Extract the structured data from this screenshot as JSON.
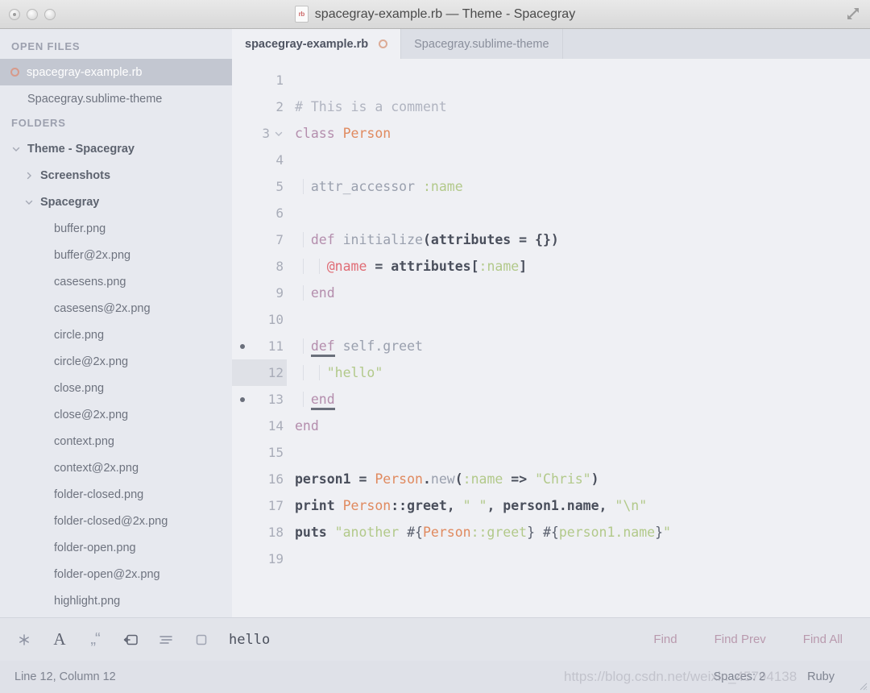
{
  "window": {
    "title": "spacegray-example.rb — Theme - Spacegray",
    "file_badge": "rb",
    "expand_icon": "fullscreen-icon"
  },
  "sidebar": {
    "open_files_header": "OPEN FILES",
    "open_files": [
      {
        "label": "spacegray-example.rb",
        "selected": true,
        "icon": "modified-circle-icon"
      },
      {
        "label": "Spacegray.sublime-theme",
        "selected": false
      }
    ],
    "folders_header": "FOLDERS",
    "folders": [
      {
        "label": "Theme - Spacegray",
        "expanded": true,
        "depth": 0
      },
      {
        "label": "Screenshots",
        "expanded": false,
        "depth": 1
      },
      {
        "label": "Spacegray",
        "expanded": true,
        "depth": 1
      }
    ],
    "files": [
      "buffer.png",
      "buffer@2x.png",
      "casesens.png",
      "casesens@2x.png",
      "circle.png",
      "circle@2x.png",
      "close.png",
      "close@2x.png",
      "context.png",
      "context@2x.png",
      "folder-closed.png",
      "folder-closed@2x.png",
      "folder-open.png",
      "folder-open@2x.png",
      "highlight.png"
    ]
  },
  "tabs": [
    {
      "label": "spacegray-example.rb",
      "active": true,
      "modified": true
    },
    {
      "label": "Spacegray.sublime-theme",
      "active": false,
      "modified": false
    }
  ],
  "editor": {
    "current_line": 12,
    "bookmarked_lines": [
      11,
      13
    ],
    "fold_lines": [
      3
    ],
    "lines": [
      {
        "n": 1,
        "tokens": []
      },
      {
        "n": 2,
        "tokens": [
          {
            "t": "# This is a comment",
            "c": "c-comment"
          }
        ]
      },
      {
        "n": 3,
        "tokens": [
          {
            "t": "class ",
            "c": "c-keyword"
          },
          {
            "t": "Person",
            "c": "c-class"
          }
        ]
      },
      {
        "n": 4,
        "tokens": []
      },
      {
        "n": 5,
        "tokens": [
          {
            "t": "  attr_accessor ",
            "c": "c-func"
          },
          {
            "t": ":name",
            "c": "c-symbol"
          }
        ]
      },
      {
        "n": 6,
        "tokens": []
      },
      {
        "n": 7,
        "tokens": [
          {
            "t": "  def ",
            "c": "c-keyword"
          },
          {
            "t": "initialize",
            "c": "c-func"
          },
          {
            "t": "(",
            "c": "c-bold"
          },
          {
            "t": "attributes",
            "c": "c-bold"
          },
          {
            "t": " = {})",
            "c": "c-bold"
          }
        ]
      },
      {
        "n": 8,
        "tokens": [
          {
            "t": "    ",
            "c": "c-plain"
          },
          {
            "t": "@name",
            "c": "c-ivar"
          },
          {
            "t": " = ",
            "c": "c-bold"
          },
          {
            "t": "attributes",
            "c": "c-bold"
          },
          {
            "t": "[",
            "c": "c-bold"
          },
          {
            "t": ":name",
            "c": "c-symbol"
          },
          {
            "t": "]",
            "c": "c-bold"
          }
        ]
      },
      {
        "n": 9,
        "tokens": [
          {
            "t": "  end",
            "c": "c-keyword"
          }
        ]
      },
      {
        "n": 10,
        "tokens": []
      },
      {
        "n": 11,
        "tokens": [
          {
            "t": "  ",
            "c": "c-plain"
          },
          {
            "t": "def",
            "c": "c-keyword underline"
          },
          {
            "t": " self.greet",
            "c": "c-func"
          }
        ]
      },
      {
        "n": 12,
        "tokens": [
          {
            "t": "    ",
            "c": "c-plain"
          },
          {
            "t": "\"hello\"",
            "c": "c-string"
          }
        ]
      },
      {
        "n": 13,
        "tokens": [
          {
            "t": "  ",
            "c": "c-plain"
          },
          {
            "t": "end",
            "c": "c-keyword underline"
          }
        ]
      },
      {
        "n": 14,
        "tokens": [
          {
            "t": "end",
            "c": "c-keyword"
          }
        ]
      },
      {
        "n": 15,
        "tokens": []
      },
      {
        "n": 16,
        "tokens": [
          {
            "t": "person1",
            "c": "c-bold"
          },
          {
            "t": " = ",
            "c": "c-bold"
          },
          {
            "t": "Person",
            "c": "c-class"
          },
          {
            "t": ".",
            "c": "c-bold"
          },
          {
            "t": "new",
            "c": "c-func"
          },
          {
            "t": "(",
            "c": "c-bold"
          },
          {
            "t": ":name",
            "c": "c-symbol"
          },
          {
            "t": " => ",
            "c": "c-bold"
          },
          {
            "t": "\"Chris\"",
            "c": "c-string"
          },
          {
            "t": ")",
            "c": "c-bold"
          }
        ]
      },
      {
        "n": 17,
        "tokens": [
          {
            "t": "print ",
            "c": "c-bold"
          },
          {
            "t": "Person",
            "c": "c-class"
          },
          {
            "t": "::greet, ",
            "c": "c-bold"
          },
          {
            "t": "\" \"",
            "c": "c-string"
          },
          {
            "t": ", person1.name, ",
            "c": "c-bold"
          },
          {
            "t": "\"\\n\"",
            "c": "c-string"
          }
        ]
      },
      {
        "n": 18,
        "tokens": [
          {
            "t": "puts ",
            "c": "c-bold"
          },
          {
            "t": "\"another ",
            "c": "c-string"
          },
          {
            "t": "#{",
            "c": "c-plain"
          },
          {
            "t": "Person",
            "c": "c-class"
          },
          {
            "t": "::greet",
            "c": "c-symbol"
          },
          {
            "t": "}",
            "c": "c-plain"
          },
          {
            "t": " ",
            "c": "c-string"
          },
          {
            "t": "#{",
            "c": "c-plain"
          },
          {
            "t": "person1.name",
            "c": "c-symbol"
          },
          {
            "t": "}",
            "c": "c-plain"
          },
          {
            "t": "\"",
            "c": "c-string"
          }
        ]
      },
      {
        "n": 19,
        "tokens": []
      }
    ]
  },
  "findbar": {
    "icons": [
      {
        "name": "regex-icon",
        "glyph": "✳"
      },
      {
        "name": "case-sensitive-icon",
        "glyph": "A"
      },
      {
        "name": "whole-word-icon",
        "glyph": "„“"
      },
      {
        "name": "wrap-icon",
        "glyph": "wrap"
      },
      {
        "name": "in-selection-icon",
        "glyph": "lines"
      },
      {
        "name": "highlight-results-icon",
        "glyph": "square"
      }
    ],
    "query": "hello",
    "placeholder": "Find",
    "actions": [
      "Find",
      "Find Prev",
      "Find All"
    ]
  },
  "statusbar": {
    "position": "Line 12, Column 12",
    "indent": "Spaces: 2",
    "syntax": "Ruby",
    "watermark": "https://blog.csdn.net/weixin_45794138"
  }
}
